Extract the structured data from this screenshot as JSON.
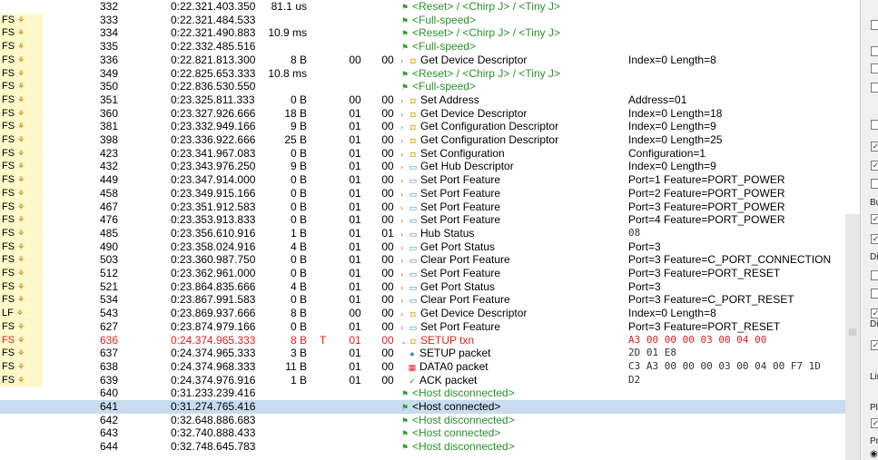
{
  "rows": [
    {
      "flag": "",
      "idx": "332",
      "time": "0:22.321.403.350",
      "dur": "81.1 us",
      "ep1": "",
      "addr": "",
      "ep": "",
      "icon": "flag",
      "rec": "<Reset> / <Chirp J> / <Tiny J>",
      "recColor": "green",
      "sum": "",
      "sel": false
    },
    {
      "flag": "FS",
      "idx": "333",
      "time": "0:22.321.484.533",
      "dur": "",
      "ep1": "",
      "addr": "",
      "ep": "",
      "icon": "flag",
      "rec": "<Full-speed>",
      "recColor": "green",
      "sum": "",
      "sel": false
    },
    {
      "flag": "FS",
      "idx": "334",
      "time": "0:22.321.490.883",
      "dur": "10.9 ms",
      "ep1": "",
      "addr": "",
      "ep": "",
      "icon": "flag",
      "rec": "<Reset> / <Chirp J> / <Tiny J>",
      "recColor": "green",
      "sum": "",
      "sel": false
    },
    {
      "flag": "FS",
      "idx": "335",
      "time": "0:22.332.485.516",
      "dur": "",
      "ep1": "",
      "addr": "",
      "ep": "",
      "icon": "flag",
      "rec": "<Full-speed>",
      "recColor": "green",
      "sum": "",
      "sel": false
    },
    {
      "flag": "FS",
      "idx": "336",
      "time": "0:22.821.813.300",
      "dur": "8 B",
      "ep1": "",
      "addr": "00",
      "ep": "00",
      "icon": "gd",
      "rec": "Get Device Descriptor",
      "recColor": "",
      "sum": "Index=0 Length=8",
      "sel": false
    },
    {
      "flag": "FS",
      "idx": "349",
      "time": "0:22.825.653.333",
      "dur": "10.8 ms",
      "ep1": "",
      "addr": "",
      "ep": "",
      "icon": "flag",
      "rec": "<Reset> / <Chirp J> / <Tiny J>",
      "recColor": "green",
      "sum": "",
      "sel": false
    },
    {
      "flag": "FS",
      "idx": "350",
      "time": "0:22.836.530.550",
      "dur": "",
      "ep1": "",
      "addr": "",
      "ep": "",
      "icon": "flag",
      "rec": "<Full-speed>",
      "recColor": "green",
      "sum": "",
      "sel": false
    },
    {
      "flag": "FS",
      "idx": "351",
      "time": "0:23.325.811.333",
      "dur": "0 B",
      "ep1": "",
      "addr": "00",
      "ep": "00",
      "icon": "gd",
      "rec": "Set Address",
      "recColor": "",
      "sum": "Address=01",
      "sel": false
    },
    {
      "flag": "FS",
      "idx": "360",
      "time": "0:23.327.926.666",
      "dur": "18 B",
      "ep1": "",
      "addr": "01",
      "ep": "00",
      "icon": "gd",
      "rec": "Get Device Descriptor",
      "recColor": "",
      "sum": "Index=0 Length=18",
      "sel": false
    },
    {
      "flag": "FS",
      "idx": "381",
      "time": "0:23.332.949.166",
      "dur": "9 B",
      "ep1": "",
      "addr": "01",
      "ep": "00",
      "icon": "gd",
      "rec": "Get Configuration Descriptor",
      "recColor": "",
      "sum": "Index=0 Length=9",
      "sel": false
    },
    {
      "flag": "FS",
      "idx": "398",
      "time": "0:23.336.922.666",
      "dur": "25 B",
      "ep1": "",
      "addr": "01",
      "ep": "00",
      "icon": "gd",
      "rec": "Get Configuration Descriptor",
      "recColor": "",
      "sum": "Index=0 Length=25",
      "sel": false
    },
    {
      "flag": "FS",
      "idx": "423",
      "time": "0:23.341.967.083",
      "dur": "0 B",
      "ep1": "",
      "addr": "01",
      "ep": "00",
      "icon": "gd",
      "rec": "Set Configuration",
      "recColor": "",
      "sum": "Configuration=1",
      "sel": false
    },
    {
      "flag": "FS",
      "idx": "432",
      "time": "0:23.343.976.250",
      "dur": "9 B",
      "ep1": "",
      "addr": "01",
      "ep": "00",
      "icon": "hub",
      "rec": "Get Hub Descriptor",
      "recColor": "",
      "sum": "Index=0 Length=9",
      "sel": false
    },
    {
      "flag": "FS",
      "idx": "449",
      "time": "0:23.347.914.000",
      "dur": "0 B",
      "ep1": "",
      "addr": "01",
      "ep": "00",
      "icon": "hub",
      "rec": "Set Port Feature",
      "recColor": "",
      "sum": "Port=1 Feature=PORT_POWER",
      "sel": false
    },
    {
      "flag": "FS",
      "idx": "458",
      "time": "0:23.349.915.166",
      "dur": "0 B",
      "ep1": "",
      "addr": "01",
      "ep": "00",
      "icon": "hub",
      "rec": "Set Port Feature",
      "recColor": "",
      "sum": "Port=2 Feature=PORT_POWER",
      "sel": false
    },
    {
      "flag": "FS",
      "idx": "467",
      "time": "0:23.351.912.583",
      "dur": "0 B",
      "ep1": "",
      "addr": "01",
      "ep": "00",
      "icon": "hub",
      "rec": "Set Port Feature",
      "recColor": "",
      "sum": "Port=3 Feature=PORT_POWER",
      "sel": false
    },
    {
      "flag": "FS",
      "idx": "476",
      "time": "0:23.353.913.833",
      "dur": "0 B",
      "ep1": "",
      "addr": "01",
      "ep": "00",
      "icon": "hub",
      "rec": "Set Port Feature",
      "recColor": "",
      "sum": "Port=4 Feature=PORT_POWER",
      "sel": false
    },
    {
      "flag": "FS",
      "idx": "485",
      "time": "0:23.356.610.916",
      "dur": "1 B",
      "ep1": "",
      "addr": "01",
      "ep": "01",
      "icon": "hub",
      "rec": "Hub Status",
      "recColor": "",
      "sum": "08",
      "sumMono": true,
      "sel": false
    },
    {
      "flag": "FS",
      "idx": "490",
      "time": "0:23.358.024.916",
      "dur": "4 B",
      "ep1": "",
      "addr": "01",
      "ep": "00",
      "icon": "hub",
      "rec": "Get Port Status",
      "recColor": "",
      "sum": "Port=3",
      "sel": false
    },
    {
      "flag": "FS",
      "idx": "503",
      "time": "0:23.360.987.750",
      "dur": "0 B",
      "ep1": "",
      "addr": "01",
      "ep": "00",
      "icon": "hub",
      "rec": "Clear Port Feature",
      "recColor": "",
      "sum": "Port=3 Feature=C_PORT_CONNECTION",
      "sel": false
    },
    {
      "flag": "FS",
      "idx": "512",
      "time": "0:23.362.961.000",
      "dur": "0 B",
      "ep1": "",
      "addr": "01",
      "ep": "00",
      "icon": "hub",
      "rec": "Set Port Feature",
      "recColor": "",
      "sum": "Port=3 Feature=PORT_RESET",
      "sel": false
    },
    {
      "flag": "FS",
      "idx": "521",
      "time": "0:23.864.835.666",
      "dur": "4 B",
      "ep1": "",
      "addr": "01",
      "ep": "00",
      "icon": "hub",
      "rec": "Get Port Status",
      "recColor": "",
      "sum": "Port=3",
      "sel": false
    },
    {
      "flag": "FS",
      "idx": "534",
      "time": "0:23.867.991.583",
      "dur": "0 B",
      "ep1": "",
      "addr": "01",
      "ep": "00",
      "icon": "hub",
      "rec": "Clear Port Feature",
      "recColor": "",
      "sum": "Port=3 Feature=C_PORT_RESET",
      "sel": false
    },
    {
      "flag": "LF",
      "idx": "543",
      "time": "0:23.869.937.666",
      "dur": "8 B",
      "ep1": "",
      "addr": "00",
      "ep": "00",
      "icon": "gd",
      "rec": "Get Device Descriptor",
      "recColor": "",
      "sum": "Index=0 Length=8",
      "sel": false
    },
    {
      "flag": "FS",
      "idx": "627",
      "time": "0:23.874.979.166",
      "dur": "0 B",
      "ep1": "",
      "addr": "01",
      "ep": "00",
      "icon": "hub",
      "rec": "Set Port Feature",
      "recColor": "",
      "sum": "Port=3 Feature=PORT_RESET",
      "sel": false
    },
    {
      "flag": "FS",
      "idx": "636",
      "time": "0:24.374.965.333",
      "dur": "8 B",
      "ep1": "T",
      "addr": "01",
      "ep": "00",
      "icon": "gd",
      "rec": "SETUP txn",
      "recColor": "red",
      "sum": "A3 00 00 00 03 00 04 00",
      "sumMono": true,
      "sumRed": true,
      "red": true,
      "expanded": true,
      "sel": false
    },
    {
      "flag": "FS",
      "idx": "637",
      "time": "0:24.374.965.333",
      "dur": "3 B",
      "ep1": "",
      "addr": "01",
      "ep": "00",
      "icon": "setup",
      "rec": "SETUP packet",
      "recColor": "",
      "sum": "2D 01 E8",
      "sumMono": true,
      "indent": true,
      "sel": false
    },
    {
      "flag": "FS",
      "idx": "638",
      "time": "0:24.374.968.333",
      "dur": "11 B",
      "ep1": "",
      "addr": "01",
      "ep": "00",
      "icon": "data",
      "rec": "DATA0 packet",
      "recColor": "",
      "sum": "C3 A3 00 00 00 03 00 04 00 F7 1D",
      "sumMono": true,
      "indent": true,
      "sel": false
    },
    {
      "flag": "FS",
      "idx": "639",
      "time": "0:24.374.976.916",
      "dur": "1 B",
      "ep1": "",
      "addr": "01",
      "ep": "00",
      "icon": "ack",
      "rec": "ACK packet",
      "recColor": "",
      "sum": "D2",
      "sumMono": true,
      "indent": true,
      "sel": false
    },
    {
      "flag": "",
      "idx": "640",
      "time": "0:31.233.239.416",
      "dur": "",
      "ep1": "",
      "addr": "",
      "ep": "",
      "icon": "flag",
      "rec": "<Host disconnected>",
      "recColor": "green",
      "sum": "",
      "sel": false
    },
    {
      "flag": "",
      "idx": "641",
      "time": "0:31.274.765.416",
      "dur": "",
      "ep1": "",
      "addr": "",
      "ep": "",
      "icon": "flag",
      "rec": "<Host connected>",
      "recColor": "",
      "sum": "",
      "sel": true
    },
    {
      "flag": "",
      "idx": "642",
      "time": "0:32.648.886.683",
      "dur": "",
      "ep1": "",
      "addr": "",
      "ep": "",
      "icon": "flag",
      "rec": "<Host disconnected>",
      "recColor": "green",
      "sum": "",
      "sel": false
    },
    {
      "flag": "",
      "idx": "643",
      "time": "0:32.740.888.433",
      "dur": "",
      "ep1": "",
      "addr": "",
      "ep": "",
      "icon": "flag",
      "rec": "<Host connected>",
      "recColor": "green",
      "sum": "",
      "sel": false
    },
    {
      "flag": "",
      "idx": "644",
      "time": "0:32.748.645.783",
      "dur": "",
      "ep1": "",
      "addr": "",
      "ep": "",
      "icon": "flag",
      "rec": "<Host disconnected>",
      "recColor": "green",
      "sum": "",
      "sel": false
    }
  ],
  "right_panel": {
    "labels": [
      "Bu",
      "Di",
      "Di",
      "Lin",
      "Pl",
      "Pr"
    ]
  },
  "colors": {
    "green": "#2b8f2b",
    "red": "#dd2222",
    "selected": "#c7dcef",
    "flag_bg": "#fff8c8"
  }
}
